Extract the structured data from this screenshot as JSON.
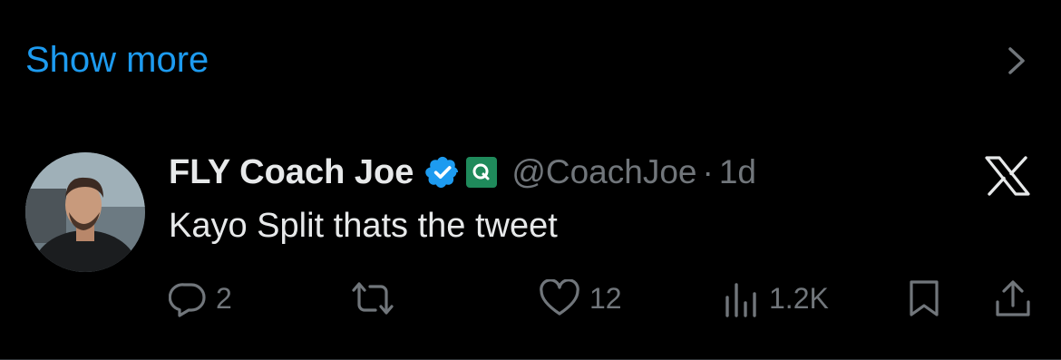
{
  "show_more": {
    "label": "Show more"
  },
  "tweet": {
    "display_name": "FLY Coach Joe",
    "handle": "@CoachJoe",
    "separator": "·",
    "time": "1d",
    "text": "Kayo Split thats the tweet"
  },
  "actions": {
    "replies": "2",
    "likes": "12",
    "views": "1.2K"
  },
  "icons": {
    "chevron": "chevron-right-icon",
    "verified": "verified-badge-icon",
    "affiliate": "affiliate-badge-icon",
    "platform": "x-logo-icon",
    "reply": "reply-icon",
    "retweet": "retweet-icon",
    "like": "heart-icon",
    "views": "views-icon",
    "bookmark": "bookmark-icon",
    "share": "share-icon"
  },
  "colors": {
    "background": "#000000",
    "link": "#1d9bf0",
    "text": "#e7e9ea",
    "muted": "#71767b",
    "affiliate": "#1f8a5b"
  }
}
